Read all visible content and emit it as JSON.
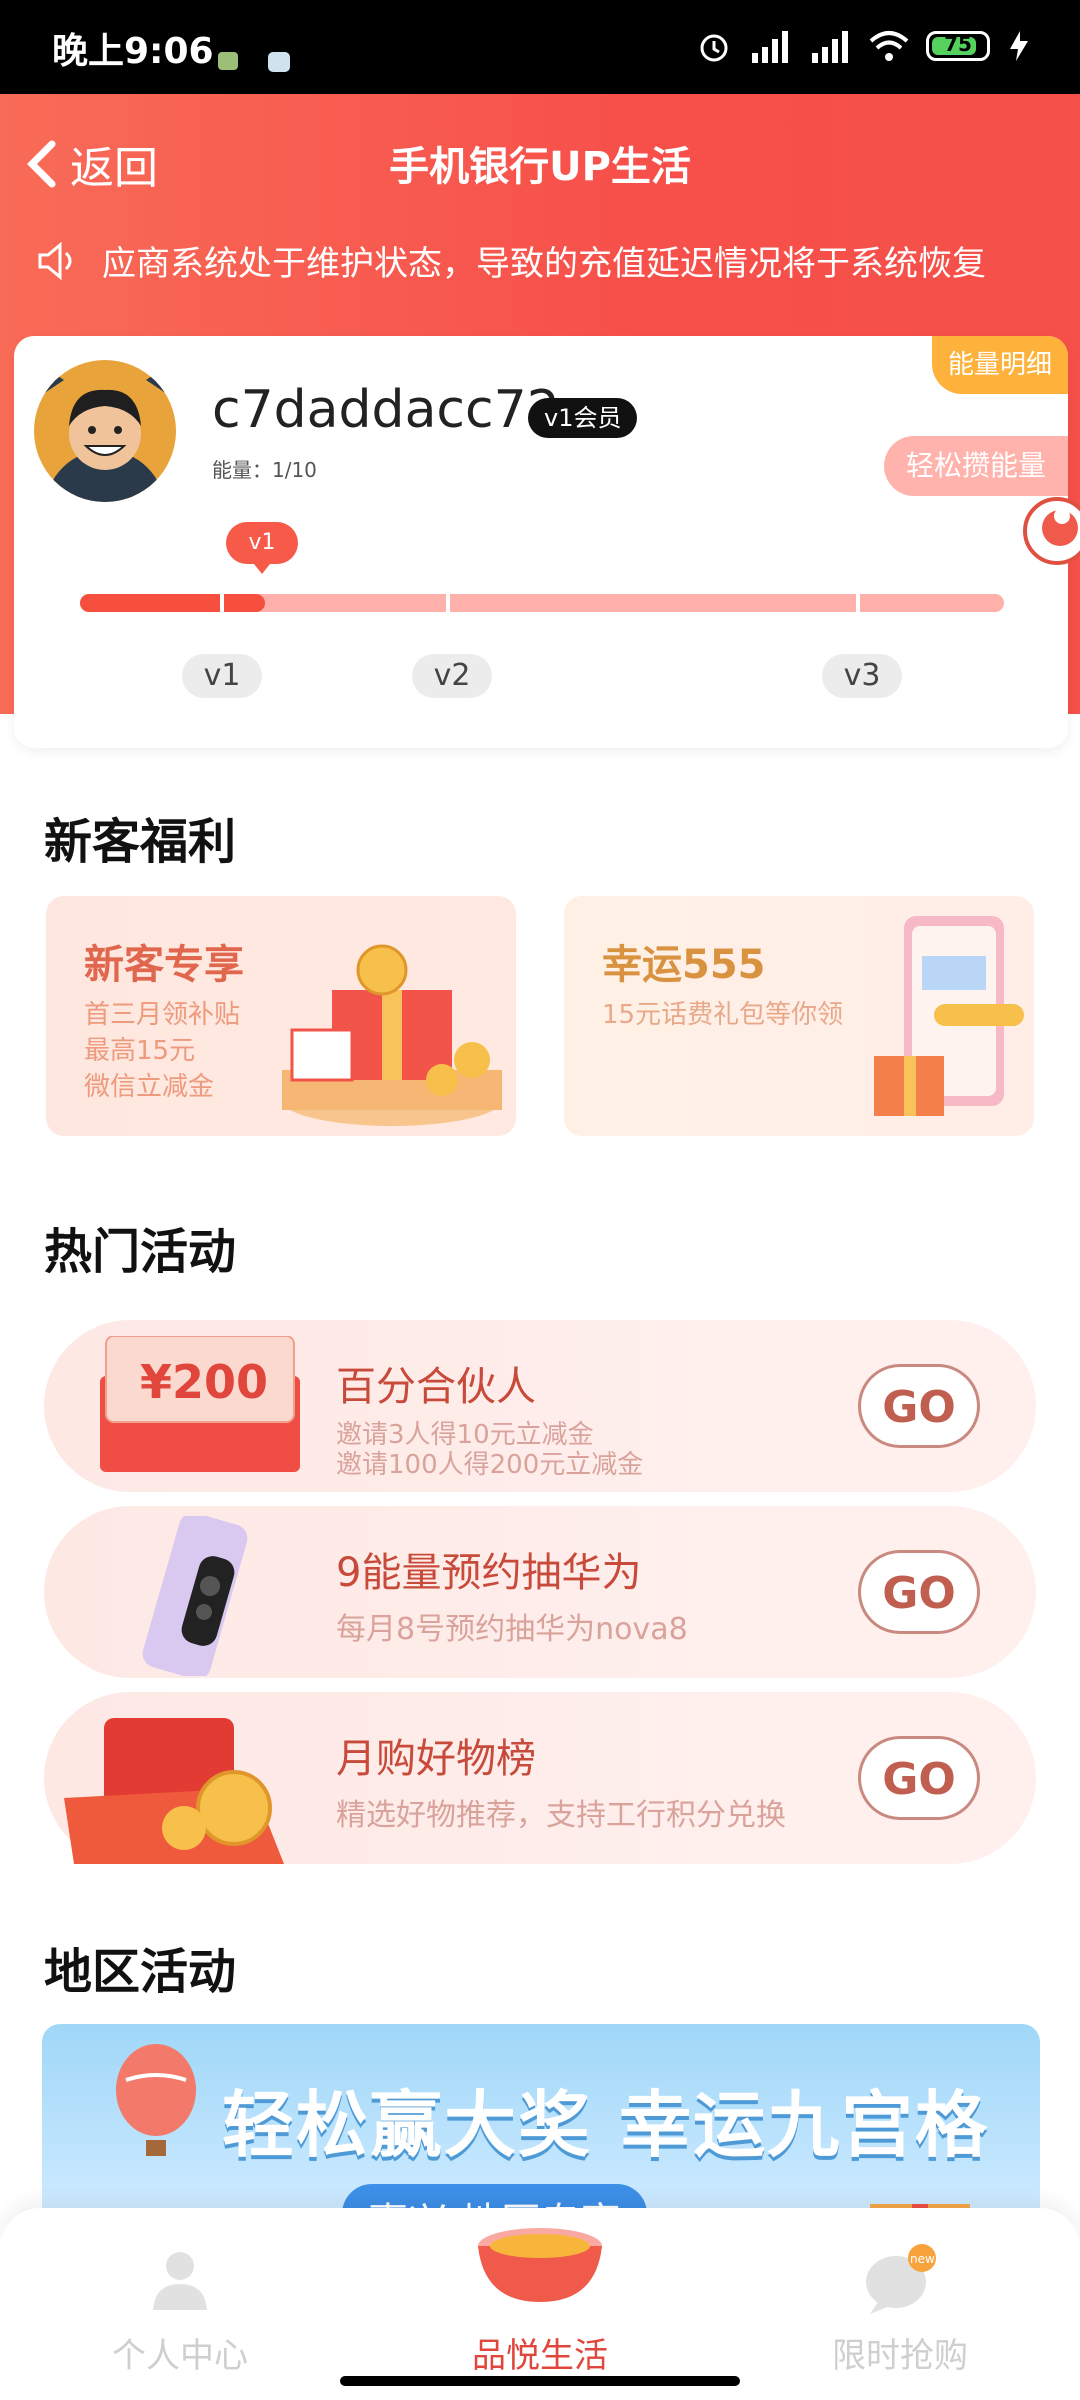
{
  "status_bar": {
    "time": "晚上9:06",
    "battery": "75"
  },
  "header": {
    "back_label": "返回",
    "title": "手机银行UP生活",
    "notice": "应商系统处于维护状态，导致的充值延迟情况将于系统恢复"
  },
  "profile": {
    "username": "c7daddacc72",
    "member_badge": "v1会员",
    "energy": "能量：1/10",
    "energy_detail": "能量明细",
    "easy_energy": "轻松攒能量",
    "current_level": "v1",
    "levels": [
      "v1",
      "v2",
      "v3"
    ],
    "progress": 0.2
  },
  "sections": {
    "new_customer": "新客福利",
    "hot_activities": "热门活动",
    "regional": "地区活动"
  },
  "promos": [
    {
      "title": "新客专享",
      "lines": [
        "首三月领补贴",
        "最高15元",
        "微信立减金"
      ]
    },
    {
      "title": "幸运555",
      "lines": [
        "15元话费礼包等你领"
      ]
    }
  ],
  "activities": [
    {
      "title": "百分合伙人",
      "lines": [
        "邀请3人得10元立减金",
        "邀请100人得200元立减金"
      ],
      "go": "GO",
      "coupon": "¥200"
    },
    {
      "title": "9能量预约抽华为",
      "lines": [
        "每月8号预约抽华为nova8"
      ],
      "go": "GO"
    },
    {
      "title": "月购好物榜",
      "lines": [
        "精选好物推荐，支持工行积分兑换"
      ],
      "go": "GO"
    }
  ],
  "banner": {
    "title": "轻松赢大奖 幸运九宫格",
    "subtitle": "嘉兴 地区专享"
  },
  "bottom_nav": [
    {
      "label": "个人中心"
    },
    {
      "label": "品悦生活"
    },
    {
      "label": "限时抢购"
    }
  ],
  "colors": {
    "header_red": "#f74f4a",
    "accent_orange": "#ffb23b",
    "active_nav": "#e0463b"
  }
}
